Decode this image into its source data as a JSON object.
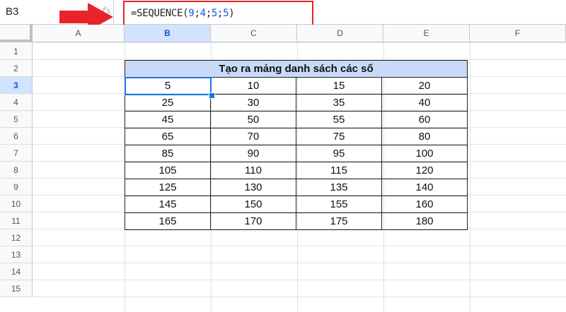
{
  "name_box": {
    "value": "B3",
    "fx_label": "fx"
  },
  "formula": {
    "prefix": "=SEQUENCE(",
    "args": [
      "9",
      "4",
      "5",
      "5"
    ],
    "separator": ";",
    "suffix": ")"
  },
  "columns": [
    "A",
    "B",
    "C",
    "D",
    "E",
    "F"
  ],
  "selected_column": "B",
  "rows": [
    "1",
    "2",
    "3",
    "4",
    "5",
    "6",
    "7",
    "8",
    "9",
    "10",
    "11",
    "12",
    "13",
    "14",
    "15"
  ],
  "selected_row": "3",
  "table": {
    "title": "Tạo ra mảng danh sách các số",
    "values": [
      [
        "5",
        "10",
        "15",
        "20"
      ],
      [
        "25",
        "30",
        "35",
        "40"
      ],
      [
        "45",
        "50",
        "55",
        "60"
      ],
      [
        "65",
        "70",
        "75",
        "80"
      ],
      [
        "85",
        "90",
        "95",
        "100"
      ],
      [
        "105",
        "110",
        "115",
        "120"
      ],
      [
        "125",
        "130",
        "135",
        "140"
      ],
      [
        "145",
        "150",
        "155",
        "160"
      ],
      [
        "165",
        "170",
        "175",
        "180"
      ]
    ]
  },
  "colors": {
    "highlight_box": "#e8232a",
    "arrow": "#e8232a",
    "selection": "#1a73e8",
    "title_fill": "#c9daf8"
  },
  "icons": [
    "arrow-right-icon",
    "fx-icon"
  ]
}
